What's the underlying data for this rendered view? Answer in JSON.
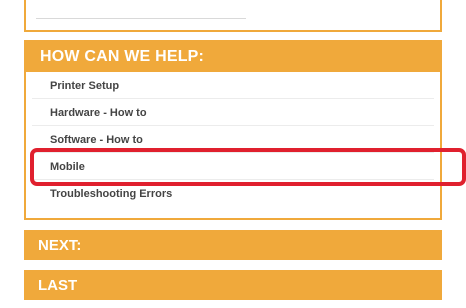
{
  "help": {
    "title": "HOW CAN WE HELP:",
    "items": [
      {
        "label": "Printer Setup"
      },
      {
        "label": "Hardware - How to"
      },
      {
        "label": "Software - How to"
      },
      {
        "label": "Mobile"
      },
      {
        "label": "Troubleshooting Errors"
      }
    ]
  },
  "sections": {
    "next_label": "NEXT:",
    "last_label": "LAST"
  },
  "colors": {
    "accent": "#f0a93b",
    "highlight": "#e0202e"
  }
}
